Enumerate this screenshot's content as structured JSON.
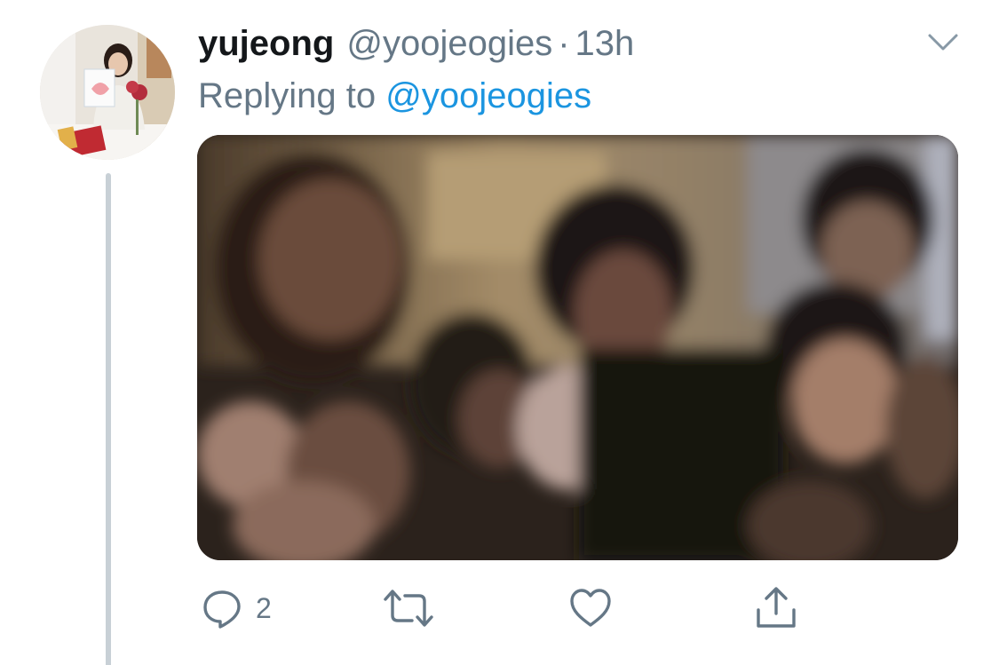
{
  "tweet": {
    "display_name": "yujeong",
    "handle": "@yoojeogies",
    "separator": "·",
    "time": "13h",
    "replying_prefix": "Replying to",
    "replying_to": "@yoojeogies",
    "menu_icon": "chevron-down-icon",
    "media_type": "photo"
  },
  "actions": {
    "reply": {
      "icon": "reply-icon",
      "count": "2"
    },
    "retweet": {
      "icon": "retweet-icon"
    },
    "like": {
      "icon": "heart-icon"
    },
    "share": {
      "icon": "share-icon"
    }
  },
  "colors": {
    "name": "#14171a",
    "secondary": "#657786",
    "link": "#1b95e0",
    "thread_line": "#c8d0d6"
  }
}
